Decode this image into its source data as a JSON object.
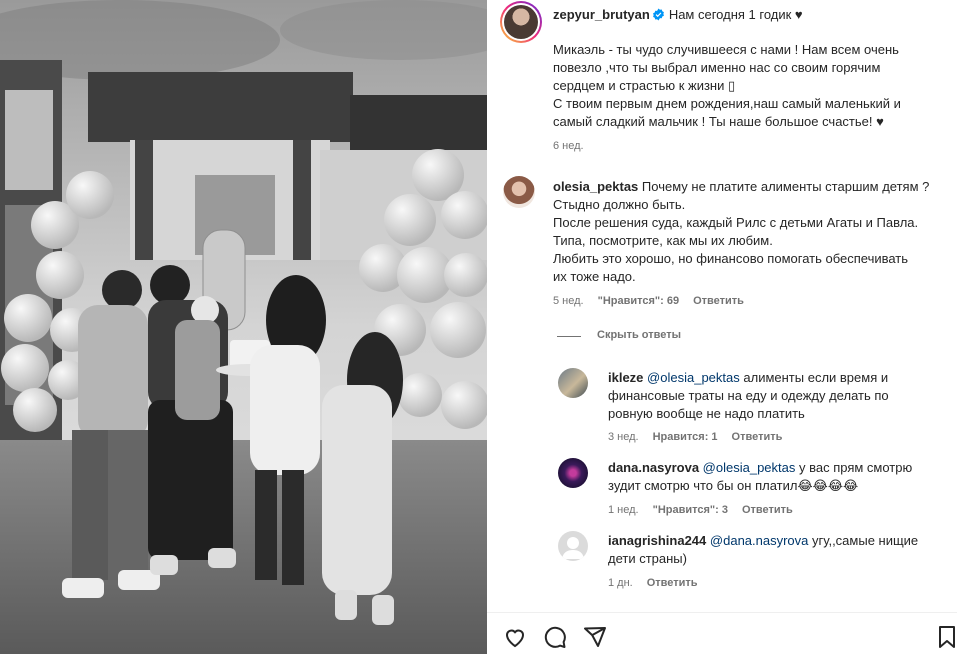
{
  "post": {
    "author": "zepyur_brutyan",
    "headline": "Нам сегодня 1 годик ♥",
    "caption_lines": [
      "Микаэль - ты чудо случившееся с нами ! Нам всем очень",
      "повезло ,что ты выбрал именно нас со своим горячим",
      "сердцем и страстью к жизни ▯",
      "С твоим первым днем рождения,наш самый маленький и",
      "самый сладкий мальчик ! Ты наше большое счастье! ♥"
    ],
    "time": "6 нед."
  },
  "comments": [
    {
      "user": "olesia_pektas",
      "lines": [
        "Почему не платите алименты старшим детям ?",
        "Стыдно должно быть.",
        "После решения суда, каждый Рилс с детьми Агаты и Павла.",
        "Типа, посмотрите, как мы их любим.",
        "Любить это хорошо, но финансово помогать обеспечивать",
        "их тоже надо."
      ],
      "time": "5 нед.",
      "likes": "\"Нравится\": 69",
      "reply": "Ответить",
      "hide_replies": "Скрыть ответы"
    }
  ],
  "replies": [
    {
      "user": "ikleze",
      "mention": "@olesia_pektas",
      "line1": "алименты если время и",
      "lines": [
        "финансовые траты на еду и одежду делать по",
        "ровную вообще не надо платить"
      ],
      "time": "3 нед.",
      "likes": "Нравится: 1",
      "reply": "Ответить"
    },
    {
      "user": "dana.nasyrova",
      "mention": "@olesia_pektas",
      "line1": "у вас прям смотрю",
      "lines": [
        "зудит смотрю что бы он платил😂😂😂😂"
      ],
      "time": "1 нед.",
      "likes": "\"Нравится\": 3",
      "reply": "Ответить"
    },
    {
      "user": "ianagrishina244",
      "mention": "@dana.nasyrova",
      "line1": "угу,,самые нищие",
      "lines": [
        "дети страны)"
      ],
      "time": "1 дн.",
      "likes": "",
      "reply": "Ответить"
    }
  ],
  "icons": [
    "heart-icon",
    "comment-icon",
    "share-icon",
    "bookmark-icon",
    "verified-badge-icon"
  ],
  "colors": {
    "verified": "#0095f6",
    "mention": "#00376b",
    "muted": "#737373"
  }
}
